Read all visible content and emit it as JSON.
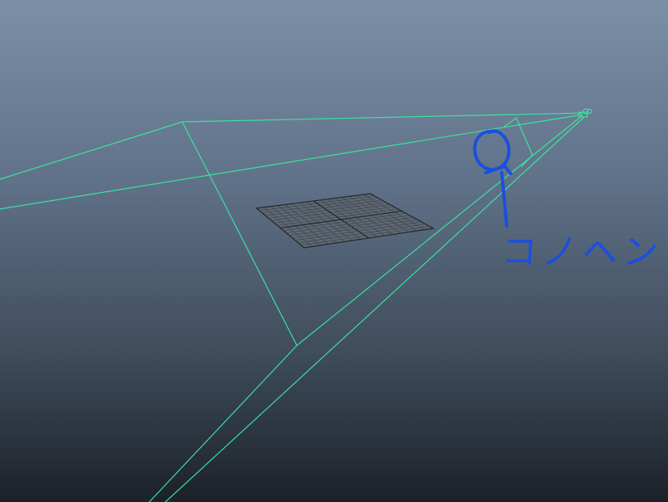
{
  "viewport": {
    "background_top": "#7b8fa6",
    "background_bottom": "#1c2128"
  },
  "camera": {
    "icon": "camera-icon",
    "frustum_color": "#39e3a0"
  },
  "ground_grid": {
    "color": "#5f6872",
    "line_color": "#3a424b"
  },
  "annotation": {
    "label": "コノヘン",
    "color": "#1a4fe0",
    "icon": "hand-drawn-pointer-icon"
  }
}
